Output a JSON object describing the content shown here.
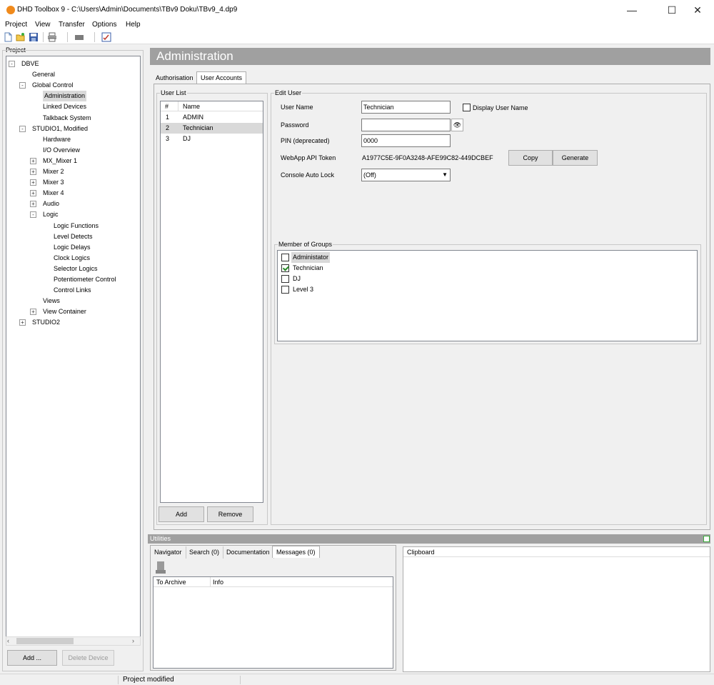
{
  "window": {
    "title": "DHD Toolbox 9 - C:\\Users\\Admin\\Documents\\TBv9 Doku\\TBv9_4.dp9",
    "controls": {
      "minimize": "—",
      "maximize": "☐",
      "close": "✕"
    }
  },
  "menu": [
    "Project",
    "View",
    "Transfer",
    "Options",
    "Help"
  ],
  "project_panel": {
    "label": "Project",
    "tree": [
      {
        "label": "DBVE",
        "indent": 0,
        "exp": "-"
      },
      {
        "label": "General",
        "indent": 1,
        "exp": ""
      },
      {
        "label": "Global Control",
        "indent": 1,
        "exp": "-"
      },
      {
        "label": "Administration",
        "indent": 2,
        "exp": "",
        "selected": true
      },
      {
        "label": "Linked Devices",
        "indent": 2,
        "exp": ""
      },
      {
        "label": "Talkback System",
        "indent": 2,
        "exp": ""
      },
      {
        "label": "STUDIO1, Modified",
        "indent": 1,
        "exp": "-"
      },
      {
        "label": "Hardware",
        "indent": 2,
        "exp": ""
      },
      {
        "label": "I/O Overview",
        "indent": 2,
        "exp": ""
      },
      {
        "label": "MX_Mixer 1",
        "indent": 2,
        "exp": "+"
      },
      {
        "label": "Mixer 2",
        "indent": 2,
        "exp": "+"
      },
      {
        "label": "Mixer 3",
        "indent": 2,
        "exp": "+"
      },
      {
        "label": "Mixer 4",
        "indent": 2,
        "exp": "+"
      },
      {
        "label": "Audio",
        "indent": 2,
        "exp": "+"
      },
      {
        "label": "Logic",
        "indent": 2,
        "exp": "-"
      },
      {
        "label": "Logic Functions",
        "indent": 3,
        "exp": ""
      },
      {
        "label": "Level Detects",
        "indent": 3,
        "exp": ""
      },
      {
        "label": "Logic Delays",
        "indent": 3,
        "exp": ""
      },
      {
        "label": "Clock Logics",
        "indent": 3,
        "exp": ""
      },
      {
        "label": "Selector Logics",
        "indent": 3,
        "exp": ""
      },
      {
        "label": "Potentiometer Control",
        "indent": 3,
        "exp": ""
      },
      {
        "label": "Control Links",
        "indent": 3,
        "exp": ""
      },
      {
        "label": "Views",
        "indent": 2,
        "exp": ""
      },
      {
        "label": "View Container",
        "indent": 2,
        "exp": "+"
      },
      {
        "label": "STUDIO2",
        "indent": 1,
        "exp": "+"
      }
    ],
    "add_button": "Add ...",
    "delete_button": "Delete Device"
  },
  "header": {
    "title": "Administration"
  },
  "tabs": [
    {
      "label": "Authorisation",
      "active": false
    },
    {
      "label": "User Accounts",
      "active": true
    }
  ],
  "user_list": {
    "label": "User List",
    "columns": [
      "#",
      "Name"
    ],
    "rows": [
      {
        "num": "1",
        "name": "ADMIN",
        "selected": false
      },
      {
        "num": "2",
        "name": "Technician",
        "selected": true
      },
      {
        "num": "3",
        "name": "DJ",
        "selected": false
      }
    ],
    "add_button": "Add",
    "remove_button": "Remove"
  },
  "edit_user": {
    "label": "Edit User",
    "user_name_label": "User Name",
    "user_name_value": "Technician",
    "display_user_name_label": "Display User Name",
    "display_user_name_checked": false,
    "password_label": "Password",
    "password_value": "",
    "pin_label": "PIN (deprecated)",
    "pin_value": "0000",
    "token_label": "WebApp API Token",
    "token_value": "A1977C5E-9F0A3248-AFE99C82-449DCBEF",
    "copy_button": "Copy",
    "generate_button": "Generate",
    "auto_lock_label": "Console Auto Lock",
    "auto_lock_value": "(Off)"
  },
  "groups": {
    "label": "Member of Groups",
    "items": [
      {
        "label": "Administator",
        "checked": false,
        "highlight": true
      },
      {
        "label": "Technician",
        "checked": true,
        "highlight": false
      },
      {
        "label": "DJ",
        "checked": false,
        "highlight": false
      },
      {
        "label": "Level 3",
        "checked": false,
        "highlight": false
      }
    ]
  },
  "utilities": {
    "title": "Utilities",
    "tabs": [
      "Navigator",
      "Search (0)",
      "Documentation",
      "Messages (0)"
    ],
    "active_tab": "Messages (0)",
    "columns": [
      "To Archive",
      "Info"
    ],
    "clipboard_label": "Clipboard"
  },
  "status": {
    "text": "Project modified"
  },
  "colors": {
    "header_bg": "#a0a0a0",
    "selection": "#d9d9d9",
    "accent_orange": "#f08a1c",
    "check_green": "#2a8a2a"
  }
}
